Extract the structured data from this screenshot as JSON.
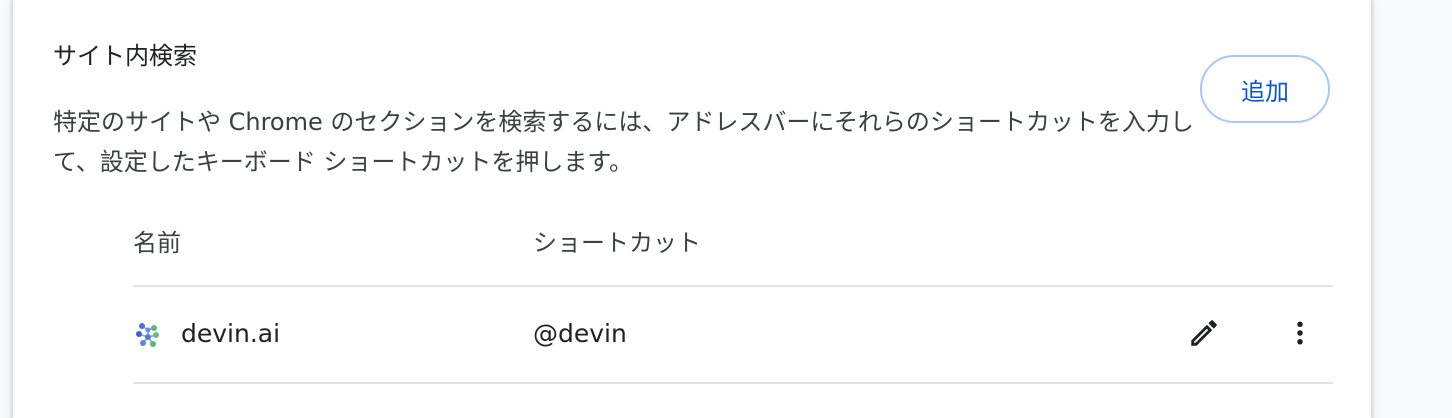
{
  "section": {
    "title": "サイト内検索",
    "description": "特定のサイトや Chrome のセクションを検索するには、アドレスバーにそれらのショートカットを入力して、設定したキーボード ショートカットを押します。",
    "add_button_label": "追加"
  },
  "table": {
    "columns": {
      "name": "名前",
      "shortcut": "ショートカット"
    },
    "rows": [
      {
        "favicon": "devin-logo-icon",
        "name": "devin.ai",
        "shortcut": "@devin",
        "actions": [
          "edit-pencil-icon",
          "more-vert-icon"
        ]
      }
    ]
  },
  "colors": {
    "accent": "#0b57d0",
    "button_border": "#a8c7fa",
    "text_primary": "#202124",
    "divider": "#e3e3e3"
  }
}
